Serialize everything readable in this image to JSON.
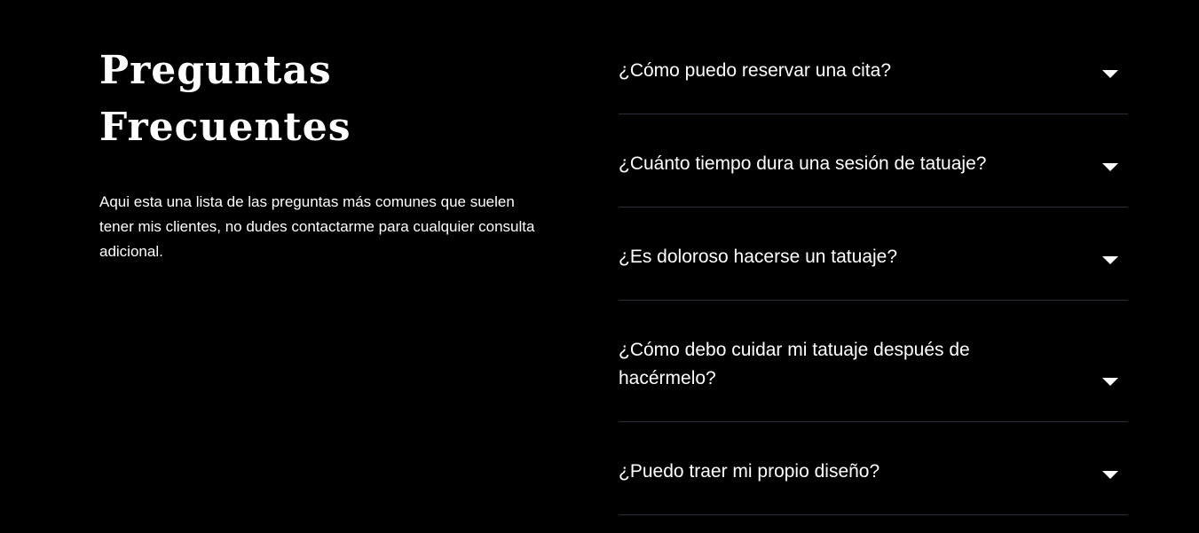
{
  "intro": {
    "title": "Preguntas Frecuentes",
    "description": "Aqui esta una lista de las preguntas más comunes que suelen tener mis clientes, no dudes contactarme para cualquier consulta adicional."
  },
  "faq": {
    "items": [
      {
        "question": "¿Cómo puedo reservar una cita?",
        "icon": "chevron-down-icon"
      },
      {
        "question": "¿Cuánto tiempo dura una sesión de tatuaje?",
        "icon": "chevron-down-icon"
      },
      {
        "question": "¿Es doloroso hacerse un tatuaje?",
        "icon": "chevron-down-icon"
      },
      {
        "question": "¿Cómo debo cuidar mi tatuaje después de hacérmelo?",
        "icon": "chevron-down-icon"
      },
      {
        "question": "¿Puedo traer mi propio diseño?",
        "icon": "chevron-down-icon"
      }
    ]
  },
  "colors": {
    "background": "#000000",
    "text": "#ffffff",
    "divider": "#2f2f3a"
  }
}
